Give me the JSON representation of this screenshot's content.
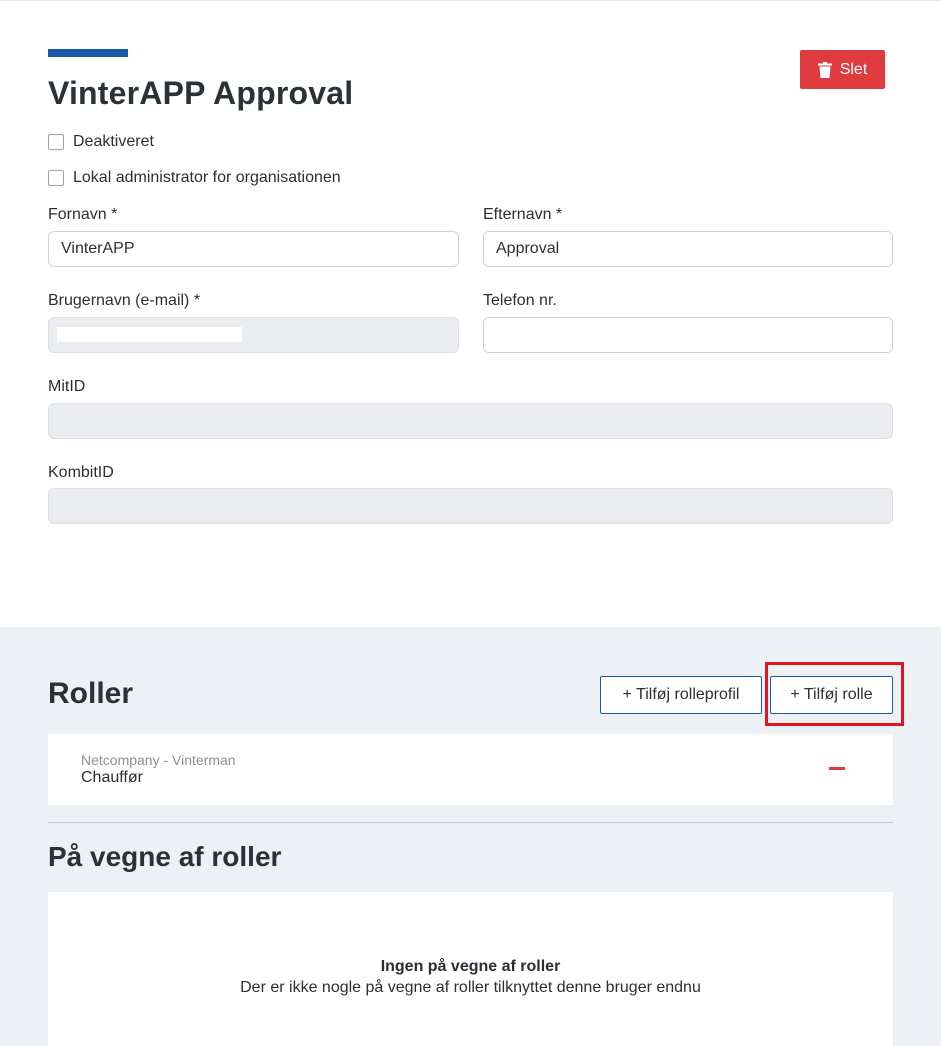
{
  "header": {
    "title": "VinterAPP Approval",
    "delete_label": "Slet"
  },
  "checkboxes": [
    {
      "label": "Deaktiveret",
      "checked": false
    },
    {
      "label": "Lokal administrator for organisationen",
      "checked": false
    }
  ],
  "form": {
    "first_name": {
      "label": "Fornavn *",
      "value": "VinterAPP"
    },
    "last_name": {
      "label": "Efternavn *",
      "value": "Approval"
    },
    "username": {
      "label": "Brugernavn (e-mail) *",
      "value": ""
    },
    "phone": {
      "label": "Telefon nr.",
      "value": ""
    },
    "mitid": {
      "label": "MitID",
      "value": ""
    },
    "kombitid": {
      "label": "KombitID",
      "value": ""
    }
  },
  "roles": {
    "title": "Roller",
    "add_profile_label": "+ Tilføj rolleprofil",
    "add_role_label": "+ Tilføj rolle",
    "items": [
      {
        "organization": "Netcompany - Vinterman",
        "name": "Chauffør"
      }
    ]
  },
  "on_behalf": {
    "title": "På vegne af roller",
    "empty_title": "Ingen på vegne af roller",
    "empty_description": "Der er ikke nogle på vegne af roller tilknyttet denne bruger endnu"
  },
  "colors": {
    "accent": "#1a5aa8",
    "danger": "#e03b3f",
    "highlight": "#e0161f",
    "section_bg": "#edf0f4"
  }
}
